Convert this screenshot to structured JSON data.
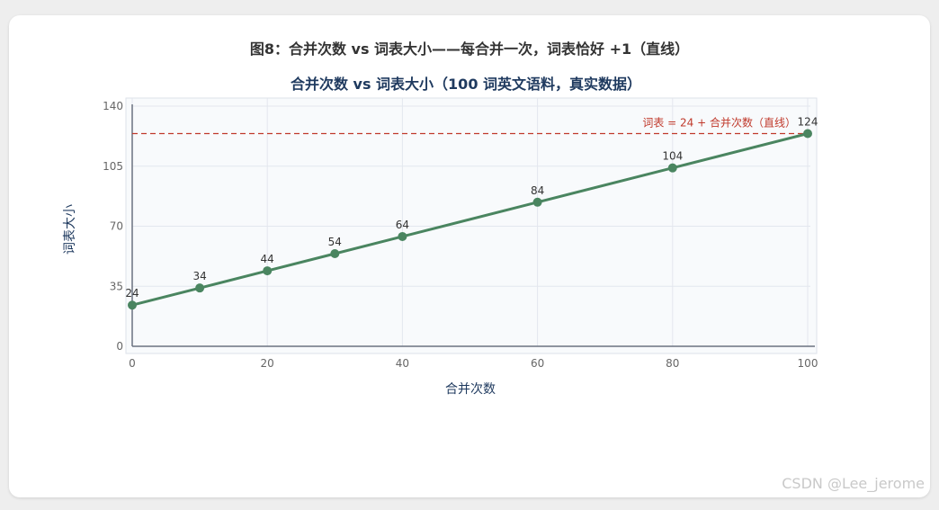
{
  "figure_title": "图8：合并次数 vs 词表大小——每合并一次，词表恰好 +1（直线）",
  "watermark": "CSDN @Lee_jerome",
  "colors": {
    "line": "#4a8560",
    "reference_line": "#c0392b",
    "title": "#1f3a5f",
    "plot_bg": "#f8fafc",
    "grid": "#e3e7ee",
    "axis": "#6b7280"
  },
  "chart_data": {
    "type": "line",
    "title": "合并次数 vs 词表大小（100 词英文语料，真实数据）",
    "xlabel": "合并次数",
    "ylabel": "词表大小",
    "xlim": [
      0,
      100
    ],
    "ylim": [
      0,
      140
    ],
    "xticks": [
      0,
      20,
      40,
      60,
      80,
      100
    ],
    "yticks": [
      0,
      35,
      70,
      105,
      140
    ],
    "grid": true,
    "series": [
      {
        "x": [
          0,
          10,
          20,
          30,
          40,
          60,
          80,
          100
        ],
        "values": [
          24,
          34,
          44,
          54,
          64,
          84,
          104,
          124
        ],
        "data_labels": [
          "24",
          "34",
          "44",
          "54",
          "64",
          "84",
          "104",
          "124"
        ]
      }
    ],
    "reference_line": {
      "y": 124,
      "label": "词表 = 24 + 合并次数（直线）"
    }
  }
}
